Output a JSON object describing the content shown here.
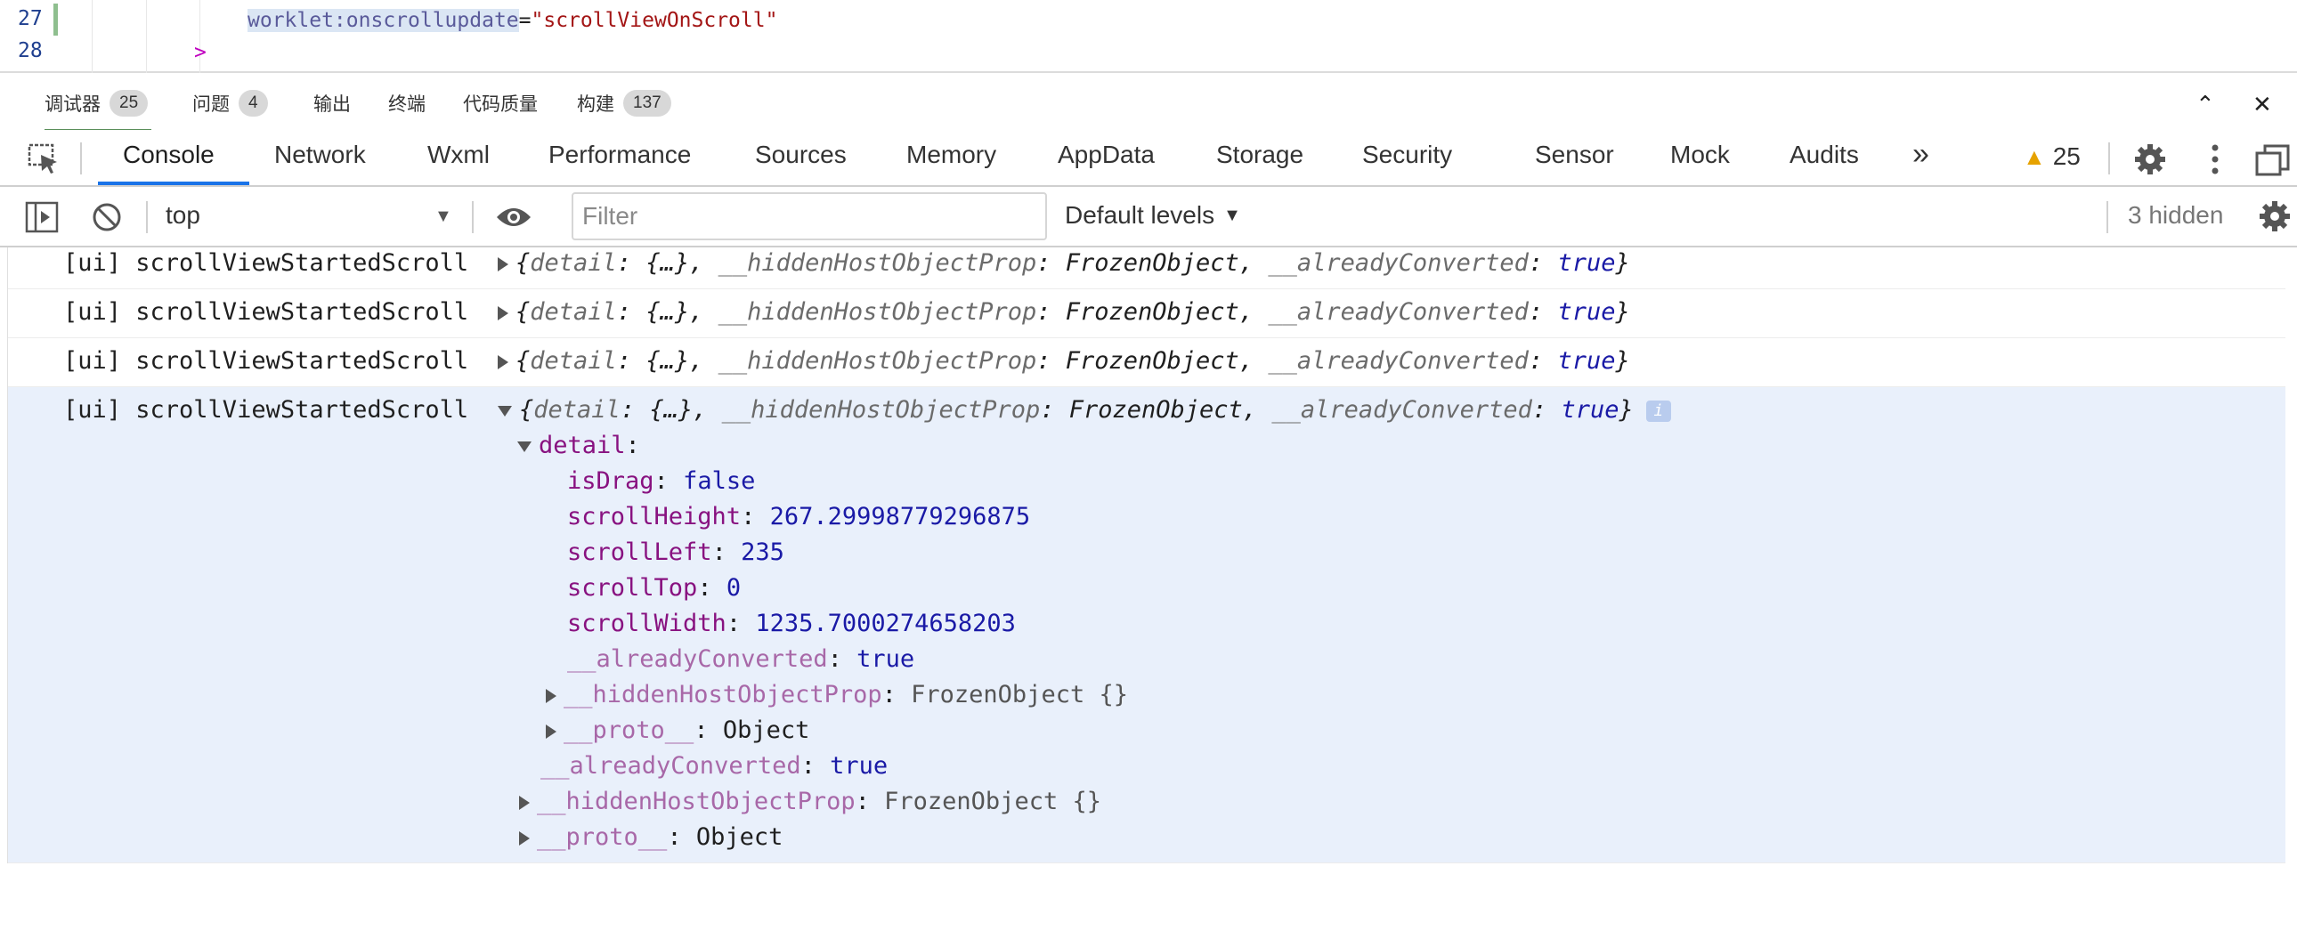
{
  "editor": {
    "lines": [
      {
        "number": "27",
        "attr": "worklet:onscrollupdate",
        "eq": "=",
        "value": "\"scrollViewOnScroll\""
      },
      {
        "number": "28",
        "text": ">"
      }
    ]
  },
  "panel_tabs": [
    {
      "label": "调试器",
      "badge": "25"
    },
    {
      "label": "问题",
      "badge": "4"
    },
    {
      "label": "输出"
    },
    {
      "label": "终端"
    },
    {
      "label": "代码质量"
    },
    {
      "label": "构建",
      "badge": "137"
    }
  ],
  "panel_controls": {
    "collapse": "⌃",
    "close": "✕"
  },
  "devtools_tabs": [
    "Console",
    "Network",
    "Wxml",
    "Performance",
    "Sources",
    "Memory",
    "AppData",
    "Storage",
    "Security",
    "Sensor",
    "Mock",
    "Audits"
  ],
  "devtools_more": "»",
  "warnings_count": "25",
  "console_toolbar": {
    "context": "top",
    "filter_placeholder": "Filter",
    "levels": "Default levels",
    "hidden": "3 hidden"
  },
  "logs": [
    {
      "prefix": "[ui] scrollViewStartedScroll",
      "summary_a": "{",
      "k1": "detail",
      "v1": ": {…}, ",
      "k2": "__hiddenHostObjectProp",
      "v2": ": FrozenObject, ",
      "k3": "__alreadyConverted",
      "v3a": ": ",
      "v3": "true",
      "end": "}"
    },
    {
      "prefix": "[ui] scrollViewStartedScroll",
      "summary_a": "{",
      "k1": "detail",
      "v1": ": {…}, ",
      "k2": "__hiddenHostObjectProp",
      "v2": ": FrozenObject, ",
      "k3": "__alreadyConverted",
      "v3a": ": ",
      "v3": "true",
      "end": "}"
    },
    {
      "prefix": "[ui] scrollViewStartedScroll",
      "summary_a": "{",
      "k1": "detail",
      "v1": ": {…}, ",
      "k2": "__hiddenHostObjectProp",
      "v2": ": FrozenObject, ",
      "k3": "__alreadyConverted",
      "v3a": ": ",
      "v3": "true",
      "end": "}"
    },
    {
      "prefix": "[ui] scrollViewStartedScroll",
      "summary_a": "{",
      "k1": "detail",
      "v1": ": {…}, ",
      "k2": "__hiddenHostObjectProp",
      "v2": ": FrozenObject, ",
      "k3": "__alreadyConverted",
      "v3a": ": ",
      "v3": "true",
      "end": "}",
      "info": "i"
    }
  ],
  "expanded": {
    "detail_key": "detail",
    "props": [
      {
        "key": "isDrag",
        "value": "false"
      },
      {
        "key": "scrollHeight",
        "value": "267.29998779296875"
      },
      {
        "key": "scrollLeft",
        "value": "235"
      },
      {
        "key": "scrollTop",
        "value": "0"
      },
      {
        "key": "scrollWidth",
        "value": "1235.7000274658203"
      }
    ],
    "inner_converted_key": "__alreadyConverted",
    "inner_converted_val": "true",
    "inner_hidden_key": "__hiddenHostObjectProp",
    "inner_hidden_val": "FrozenObject {}",
    "inner_proto_key": "__proto__",
    "inner_proto_val": "Object",
    "outer_converted_key": "__alreadyConverted",
    "outer_converted_val": "true",
    "outer_hidden_key": "__hiddenHostObjectProp",
    "outer_hidden_val": "FrozenObject {}",
    "outer_proto_key": "__proto__",
    "outer_proto_val": "Object"
  }
}
